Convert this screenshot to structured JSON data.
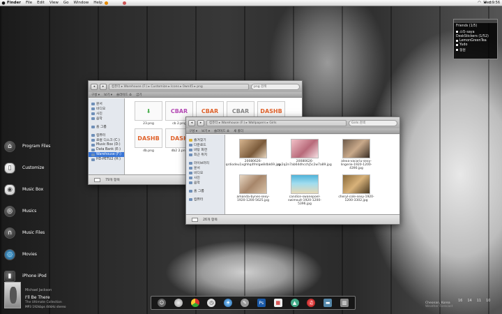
{
  "menubar": {
    "items": [
      "Finder",
      "File",
      "Edit",
      "View",
      "Go",
      "Window",
      "Help"
    ],
    "clock": "Wed 9:56"
  },
  "launcher": [
    {
      "label": "Program Files",
      "icon": "house-icon"
    },
    {
      "label": "Customize",
      "icon": "remote-icon"
    },
    {
      "label": "Music Box",
      "icon": "ipod-icon"
    },
    {
      "label": "Musics",
      "icon": "music-disc-icon"
    },
    {
      "label": "Music Files",
      "icon": "headphones-icon"
    },
    {
      "label": "Movies",
      "icon": "planet-icon"
    },
    {
      "label": "iPhone iPod",
      "icon": "iphone-icon"
    }
  ],
  "friends": {
    "title": "Friends (1/5)",
    "users": [
      "스타·saya",
      "DeskStickers (1/52)",
      "LemonGreenTea",
      "Yudo",
      "정원"
    ]
  },
  "window_back": {
    "crumbs": "컴퓨터 ▸ Warehouse (F:) ▸ Customize ▸ Icons ▸ 0wn45 ▸ png",
    "search_placeholder": "png 검색",
    "toolbar": [
      "구성 ▾",
      "보기 ▾",
      "슬라이드 쇼",
      "굽기"
    ],
    "sidebar": [
      {
        "label": "문서",
        "selected": false
      },
      {
        "label": "비디오",
        "selected": false
      },
      {
        "label": "사진",
        "selected": false
      },
      {
        "label": "음악",
        "selected": false
      },
      {
        "label": "",
        "selected": false
      },
      {
        "label": "홈 그룹",
        "selected": false
      },
      {
        "label": "",
        "selected": false
      },
      {
        "label": "컴퓨터",
        "selected": false
      },
      {
        "label": "로컬 디스크 (C:)",
        "selected": false
      },
      {
        "label": "Music Box (D:)",
        "selected": false
      },
      {
        "label": "Data Bank (E:)",
        "selected": false
      },
      {
        "label": "Warehouse (F:)",
        "selected": true
      },
      {
        "label": "HD-PETU2 (H:)",
        "selected": false
      }
    ],
    "files": [
      {
        "name": "",
        "thumb": ""
      },
      {
        "name": "",
        "thumb": "CBAR"
      },
      {
        "name": "",
        "thumb": "CBAR"
      },
      {
        "name": "",
        "thumb": "CBAR"
      },
      {
        "name": "",
        "thumb": "DASHB"
      },
      {
        "name": "23.png",
        "thumb": "↓"
      },
      {
        "name": "cb 2.png",
        "thumb": "CBAR"
      },
      {
        "name": "db.png",
        "thumb": "DASHB"
      },
      {
        "name": "db2 2.png",
        "thumb": "DASH"
      }
    ],
    "status": "79개 항목"
  },
  "window_front": {
    "crumbs": "컴퓨터 ▸ Warehouse (F:) ▸ Wallpapers ▸ Girls",
    "search_placeholder": "Girls 검색",
    "toolbar": [
      "구성 ▾",
      "보기 ▾",
      "슬라이드 쇼",
      "새 폴더"
    ],
    "sidebar": [
      {
        "label": "즐겨찾기",
        "selected": false
      },
      {
        "label": "다운로드",
        "selected": false
      },
      {
        "label": "바탕 화면",
        "selected": false
      },
      {
        "label": "최근 위치",
        "selected": false
      },
      {
        "label": "",
        "selected": false
      },
      {
        "label": "라이브러리",
        "selected": false
      },
      {
        "label": "문서",
        "selected": false
      },
      {
        "label": "비디오",
        "selected": false
      },
      {
        "label": "사진",
        "selected": false
      },
      {
        "label": "음악",
        "selected": false
      },
      {
        "label": "",
        "selected": false
      },
      {
        "label": "홈 그룹",
        "selected": false
      },
      {
        "label": "",
        "selected": false
      },
      {
        "label": "컴퓨터",
        "selected": false
      }
    ],
    "files": [
      {
        "name": "20080626-qrdiodeu1xghhq4fmlgw8dbk69.jpg"
      },
      {
        "name": "20080626-qx2q2n7ab64dhcchj5c2w7a89.jpg"
      },
      {
        "name": "alexa-vacariu-sexy-lingerie-1920-1200-4390.jpg"
      },
      {
        "name": "amanda-bynes-sexy-1920-1200-5625.jpg"
      },
      {
        "name": "candice-swanepoel-swimsuit-1920-1200-5396.jpg"
      },
      {
        "name": "cheryl-cole-sexy-1920-1200-3302.jpg"
      }
    ],
    "status": "26개 항목"
  },
  "now_playing": {
    "artist": "Michael Jackson",
    "track": "I'll Be There",
    "album": "The Ultimate Collection",
    "meta": "MP3 192kbps 44kHz stereo"
  },
  "dock": [
    "finder-icon",
    "disc-icon",
    "chrome-icon",
    "clock-icon",
    "safari-icon",
    "tools-icon",
    "photoshop-icon",
    "calendar-icon",
    "picture-icon",
    "itunes-icon",
    "folder-icon",
    "trash-icon"
  ],
  "weather": {
    "city": "Cheonan, Korea",
    "label": "Weather Forecast",
    "days": [
      "16",
      "14",
      "11",
      "10"
    ]
  }
}
